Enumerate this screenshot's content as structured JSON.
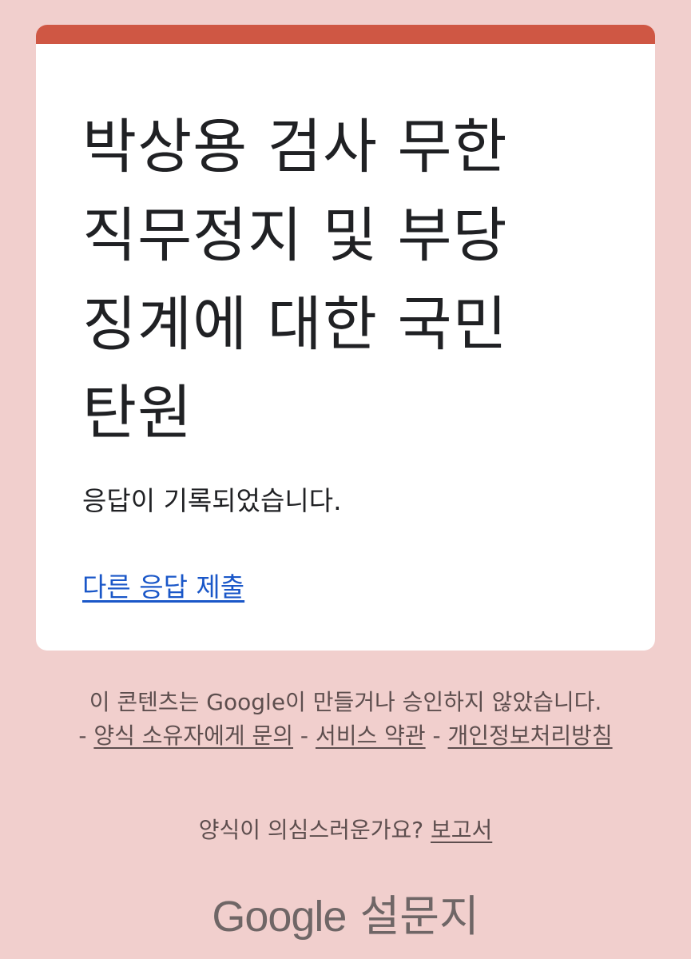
{
  "form": {
    "title": "박상용 검사 무한 직무정지 및 부당 징계에 대한 국민 탄원",
    "confirmation": "응답이 기록되었습니다.",
    "another_response": "다른 응답 제출"
  },
  "footer": {
    "disclaimer": "이 콘텐츠는 Google이 만들거나 승인하지 않았습니다.",
    "separator": " - ",
    "contact_owner": "양식 소유자에게 문의",
    "terms": "서비스 약관",
    "privacy": "개인정보처리방침",
    "suspicious": "양식이 의심스러운가요? ",
    "report": "보고서"
  },
  "brand": {
    "google": "Google",
    "forms": "설문지"
  },
  "colors": {
    "background": "#f1cfcd",
    "accent": "#cf5744",
    "link": "#1a57c8"
  }
}
